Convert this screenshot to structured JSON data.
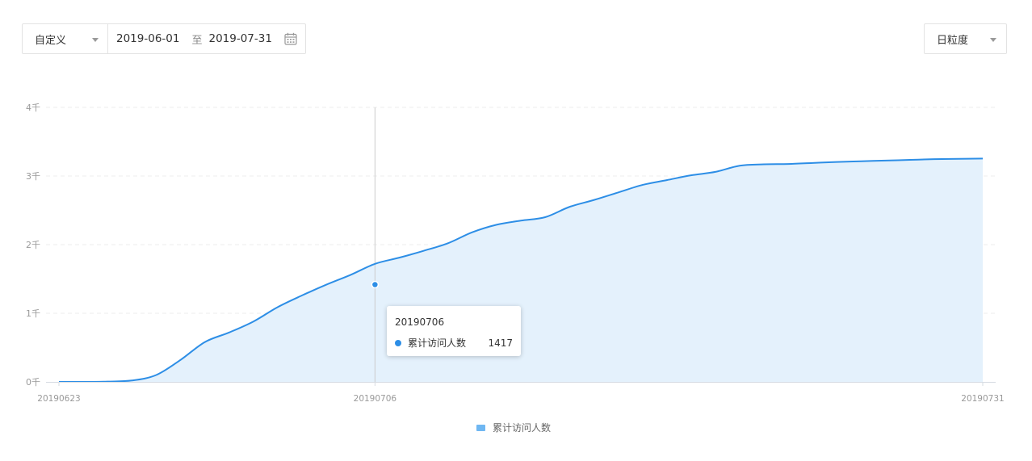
{
  "controls": {
    "mode_label": "自定义",
    "start_date": "2019-06-01",
    "separator": "至",
    "end_date": "2019-07-31",
    "granularity_label": "日粒度"
  },
  "colors": {
    "line": "#2d8ee6",
    "area": "#e4f1fc",
    "legend": "#6fb7f2",
    "grid": "#eeeeee",
    "axis": "#d6dbe2",
    "crosshair": "#cccccc"
  },
  "tooltip": {
    "title": "20190706",
    "series_name": "累计访问人数",
    "value": "1417"
  },
  "chart_data": {
    "type": "area",
    "title": "",
    "xlabel": "",
    "ylabel": "",
    "x": [
      "20190623",
      "20190624",
      "20190625",
      "20190626",
      "20190627",
      "20190628",
      "20190629",
      "20190630",
      "20190701",
      "20190702",
      "20190703",
      "20190704",
      "20190705",
      "20190706",
      "20190707",
      "20190708",
      "20190709",
      "20190710",
      "20190711",
      "20190712",
      "20190713",
      "20190714",
      "20190715",
      "20190716",
      "20190717",
      "20190718",
      "20190719",
      "20190720",
      "20190721",
      "20190722",
      "20190723",
      "20190724",
      "20190725",
      "20190726",
      "20190727",
      "20190728",
      "20190729",
      "20190730",
      "20190731"
    ],
    "x_tick_labels": [
      "20190623",
      "20190706",
      "20190731"
    ],
    "y_tick_labels": [
      "0千",
      "1千",
      "2千",
      "3千",
      "4千"
    ],
    "ylim": [
      0,
      4000
    ],
    "grid": true,
    "legend_position": "bottom",
    "series": [
      {
        "name": "累计访问人数",
        "values": [
          0,
          0,
          5,
          20,
          100,
          320,
          580,
          720,
          880,
          1090,
          1260,
          1417,
          1560,
          1720,
          1810,
          1910,
          2020,
          2180,
          2290,
          2350,
          2400,
          2550,
          2650,
          2760,
          2870,
          2940,
          3010,
          3060,
          3150,
          3170,
          3175,
          3190,
          3205,
          3215,
          3225,
          3235,
          3245,
          3250,
          3255
        ]
      }
    ],
    "highlight": {
      "x": "20190706",
      "value": 1417
    }
  }
}
